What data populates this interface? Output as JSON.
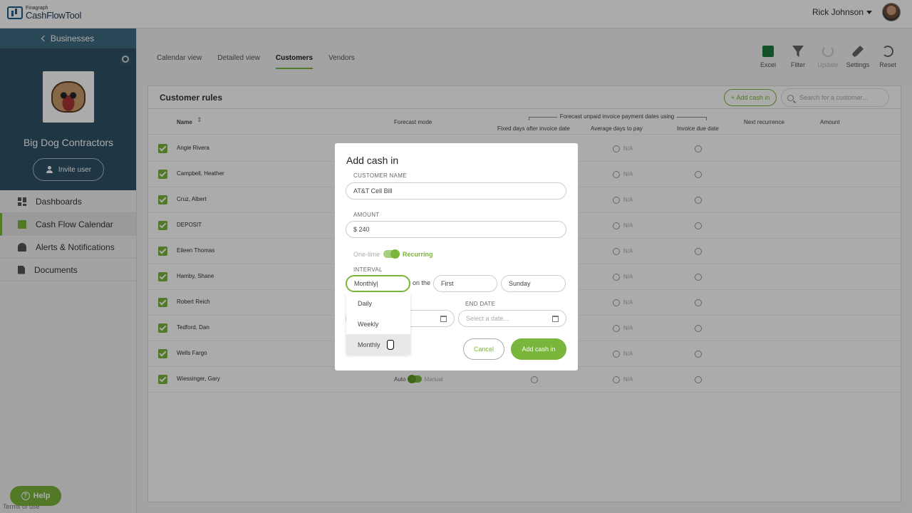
{
  "app": {
    "logo_small": "Finagraph",
    "logo_big": "CashFlowTool",
    "user_name": "Rick Johnson"
  },
  "sidebar": {
    "back_label": "Businesses",
    "business_name": "Big Dog Contractors",
    "invite_label": "Invite user",
    "items": [
      {
        "label": "Dashboards",
        "icon": "dashboard-icon"
      },
      {
        "label": "Cash Flow Calendar",
        "icon": "calendar-icon",
        "active": true
      },
      {
        "label": "Alerts & Notifications",
        "icon": "bell-icon"
      },
      {
        "label": "Documents",
        "icon": "document-icon"
      }
    ],
    "help_label": "Help",
    "terms_label": "Terms of use"
  },
  "tabs": [
    "Calendar view",
    "Detailed view",
    "Customers",
    "Vendors"
  ],
  "active_tab": "Customers",
  "toolbar": [
    "Excel",
    "Filter",
    "Update",
    "Settings",
    "Reset"
  ],
  "panel": {
    "title": "Customer rules",
    "add_label": "Add cash in",
    "search_placeholder": "Search for a customer...",
    "group_header": "Forecast unpaid invoice payment dates using",
    "columns": {
      "name": "Name",
      "mode": "Forecast mode",
      "fixed": "Fixed days after invoice date",
      "avg": "Average days to pay",
      "due": "Invoice due date",
      "next": "Next recurrence",
      "amount": "Amount"
    },
    "na_label": "N/A",
    "mode_auto": "Auto",
    "mode_manual": "Manual",
    "rows": [
      "Angie Rivera",
      "Campbell, Heather",
      "Cruz, Albert",
      "DEPOSIT",
      "Eileen Thomas",
      "Hamby, Shane",
      "Robert Reich",
      "Tedford, Dan",
      "Wells Fargo",
      "Wiessinger, Gary"
    ]
  },
  "modal": {
    "title": "Add cash in",
    "customer_label": "CUSTOMER NAME",
    "customer_value": "AT&T Cell Bill",
    "amount_label": "AMOUNT",
    "amount_value": "$ 240",
    "one_time_label": "One-time",
    "recurring_label": "Recurring",
    "interval_label": "INTERVAL",
    "interval_value": "Monthly|",
    "on_the": "on the",
    "ordinal_value": "First",
    "weekday_value": "Sunday",
    "end_date_label": "END DATE",
    "end_date_placeholder": "Select a date...",
    "cancel_label": "Cancel",
    "submit_label": "Add cash in",
    "interval_options": [
      "Daily",
      "Weekly",
      "Monthly"
    ]
  },
  "colors": {
    "accent": "#7ab53c",
    "sidebar_dark": "#2f5367"
  }
}
